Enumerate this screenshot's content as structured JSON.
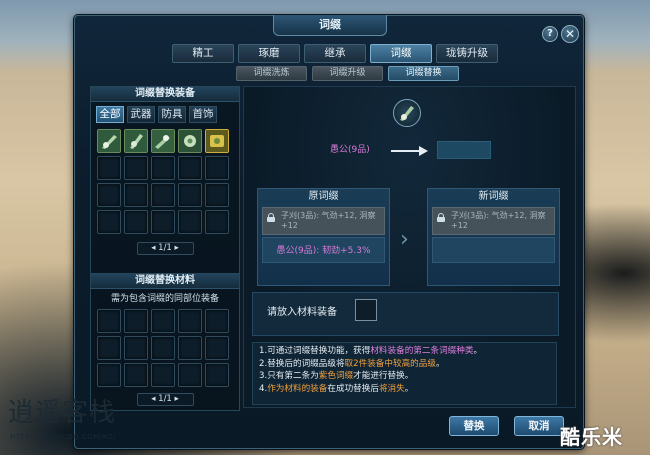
{
  "window": {
    "title": "词缀"
  },
  "main_tabs": [
    {
      "label": "精工",
      "active": false
    },
    {
      "label": "琢磨",
      "active": false
    },
    {
      "label": "继承",
      "active": false
    },
    {
      "label": "词缀",
      "active": true
    },
    {
      "label": "珑铸升级",
      "active": false
    }
  ],
  "sub_tabs": [
    {
      "label": "词缀洗炼",
      "active": false
    },
    {
      "label": "词缀升级",
      "active": false
    },
    {
      "label": "词缀替换",
      "active": true
    }
  ],
  "equip_panel": {
    "title": "词缀替换装备",
    "categories": [
      {
        "label": "全部",
        "active": true
      },
      {
        "label": "武器",
        "active": false
      },
      {
        "label": "防具",
        "active": false
      },
      {
        "label": "首饰",
        "active": false
      }
    ],
    "items": [
      {
        "icon": "jade-weapon-icon"
      },
      {
        "icon": "jade-weapon-icon"
      },
      {
        "icon": "jade-weapon-icon"
      },
      {
        "icon": "jade-charm-icon"
      },
      {
        "icon": "gold-jewelry-icon"
      }
    ],
    "pager": "1/1"
  },
  "material_panel": {
    "title": "词缀替换材料",
    "hint": "需为包含词缀的同部位装备",
    "pager": "1/1"
  },
  "replace": {
    "current_affix": "愚公(9品)",
    "old_title": "原词缀",
    "new_title": "新词缀",
    "old_locked": "子刈(3品): 气劲+12, 洞察+12",
    "old_affix": "愚公(9品): 韧劲+5.3%",
    "new_locked": "子刈(3品): 气劲+12, 洞察+12",
    "material_label": "请放入材料装备"
  },
  "notes": {
    "n1a": "1.可通过词缀替换功能，获得",
    "n1b": "材料装备的第二条词缀种类",
    "n1c": "。",
    "n2a": "2.替换后的词缀品级将",
    "n2b": "取2件装备中较高的品级",
    "n2c": "。",
    "n3a": "3.只有第二条为",
    "n3b": "紫色词缀",
    "n3c": "才能进行替换。",
    "n4a": "4.",
    "n4b": "作为材料的装备",
    "n4c": "在成功替换后",
    "n4d": "将消失",
    "n4e": "。"
  },
  "buttons": {
    "replace": "替换",
    "cancel": "取消"
  },
  "watermarks": {
    "left_text": "逍遥客栈",
    "left_url": "HTTP://WUXIA.QQ.COM/KZ/",
    "right_text": "酷乐米"
  },
  "colors": {
    "accent": "#3e78a6",
    "affix_purple": "#d77bd6",
    "highlight_orange": "#f0a040"
  }
}
